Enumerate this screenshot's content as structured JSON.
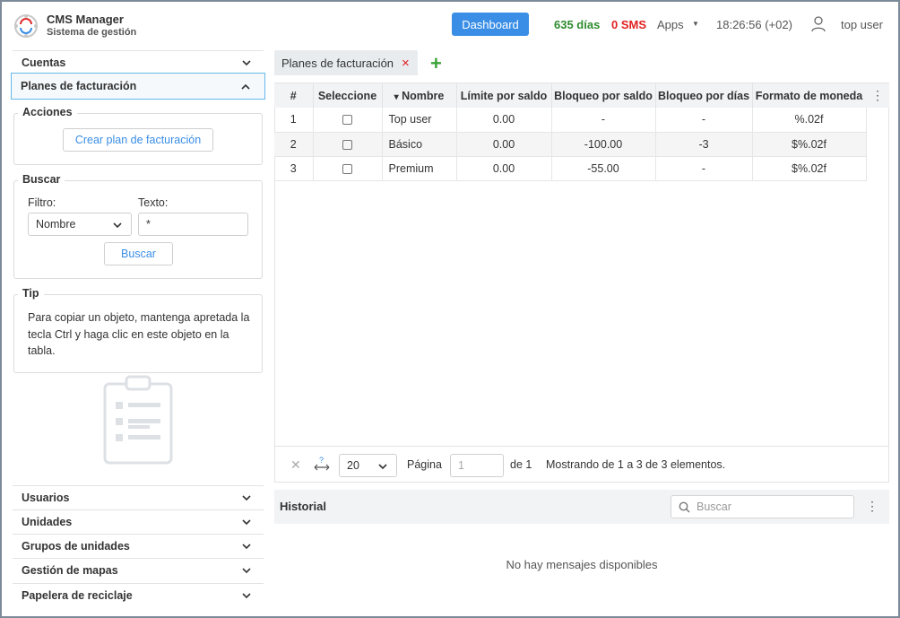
{
  "header": {
    "title": "CMS Manager",
    "subtitle": "Sistema de gestión",
    "dashboard_label": "Dashboard",
    "days": "635 días",
    "sms": "0 SMS",
    "apps_label": "Apps",
    "time": "18:26:56 (+02)",
    "user": "top user"
  },
  "sidebar": {
    "sections_top": [
      {
        "label": "Cuentas"
      },
      {
        "label": "Planes de facturación"
      }
    ],
    "actions": {
      "legend": "Acciones",
      "create_label": "Crear plan de facturación"
    },
    "search": {
      "legend": "Buscar",
      "filter_label": "Filtro:",
      "filter_value": "Nombre",
      "text_label": "Texto:",
      "text_value": "*",
      "button_label": "Buscar"
    },
    "tip": {
      "legend": "Tip",
      "text": "Para copiar un objeto, mantenga apretada la tecla Ctrl y haga clic en este objeto en la tabla."
    },
    "sections_bottom": [
      {
        "label": "Usuarios"
      },
      {
        "label": "Unidades"
      },
      {
        "label": "Grupos de unidades"
      },
      {
        "label": "Gestión de mapas"
      },
      {
        "label": "Papelera de reciclaje"
      }
    ]
  },
  "tab": {
    "label": "Planes de facturación",
    "close_symbol": "×",
    "add_symbol": "+"
  },
  "table": {
    "columns": [
      "#",
      "Seleccione",
      "Nombre",
      "Límite por saldo",
      "Bloqueo por saldo",
      "Bloqueo por días",
      "Formato de moneda"
    ],
    "sort_indicator": "▾",
    "rows": [
      {
        "num": "1",
        "name": "Top user",
        "limit": "0.00",
        "block_balance": "-",
        "block_days": "-",
        "currency": "%.02f"
      },
      {
        "num": "2",
        "name": "Básico",
        "limit": "0.00",
        "block_balance": "-100.00",
        "block_days": "-3",
        "currency": "$%.02f"
      },
      {
        "num": "3",
        "name": "Premium",
        "limit": "0.00",
        "block_balance": "-55.00",
        "block_days": "-",
        "currency": "$%.02f"
      }
    ]
  },
  "pager": {
    "page_size": "20",
    "page_label": "Página",
    "page_value": "1",
    "of_label": "de 1",
    "showing": "Mostrando de 1 a 3 de 3 elementos."
  },
  "history": {
    "title": "Historial",
    "search_placeholder": "Buscar",
    "empty": "No hay mensajes disponibles"
  },
  "colors": {
    "accent": "#3a8ee6",
    "days_green": "#2e8b2e",
    "sms_red": "#e02020",
    "add_green": "#3aa33a"
  }
}
